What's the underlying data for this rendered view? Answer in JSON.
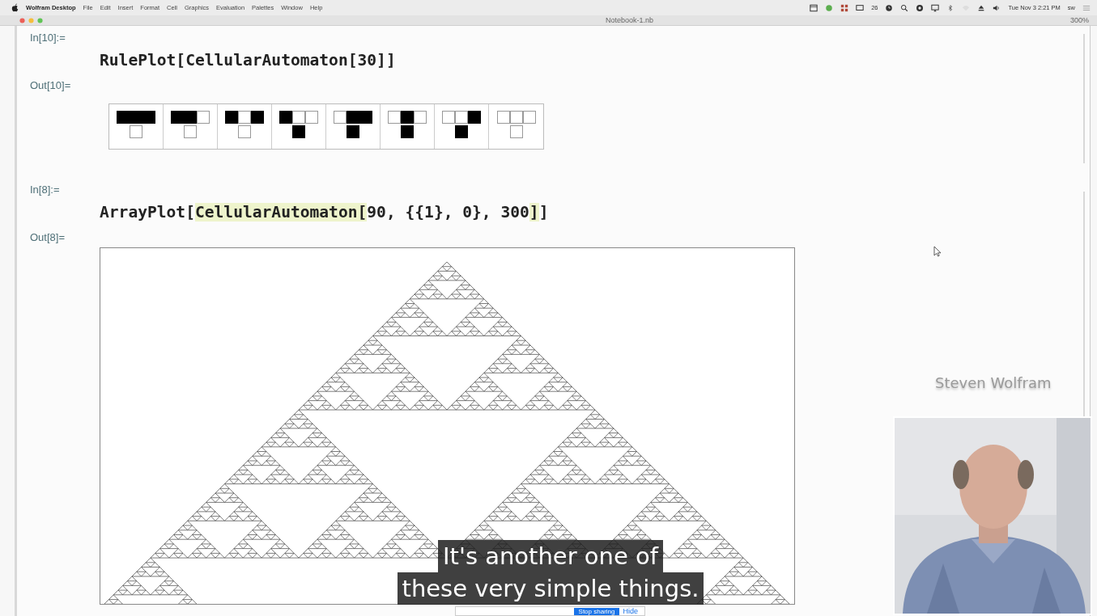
{
  "menu_bar": {
    "app": "Wolfram Desktop",
    "menus": [
      "File",
      "Edit",
      "Insert",
      "Format",
      "Cell",
      "Graphics",
      "Evaluation",
      "Palettes",
      "Window",
      "Help"
    ],
    "status": {
      "badge_count": "26",
      "clock": "Tue Nov 3  2:21 PM",
      "user": "sw"
    }
  },
  "window": {
    "title": "Notebook-1.nb",
    "zoom": "300%"
  },
  "cells": [
    {
      "kind": "input",
      "label": "In[10]:=",
      "code": [
        {
          "text": "RulePlot[CellularAutomaton[30]]",
          "highlighted": false
        }
      ]
    },
    {
      "kind": "rule_plot",
      "label": "Out[10]=",
      "cases": [
        {
          "top": [
            true,
            true,
            true
          ],
          "result": false
        },
        {
          "top": [
            true,
            true,
            false
          ],
          "result": false
        },
        {
          "top": [
            true,
            false,
            true
          ],
          "result": false
        },
        {
          "top": [
            true,
            false,
            false
          ],
          "result": true
        },
        {
          "top": [
            false,
            true,
            true
          ],
          "result": true
        },
        {
          "top": [
            false,
            true,
            false
          ],
          "result": true
        },
        {
          "top": [
            false,
            false,
            true
          ],
          "result": true
        },
        {
          "top": [
            false,
            false,
            false
          ],
          "result": false
        }
      ]
    },
    {
      "kind": "input",
      "label": "In[8]:=",
      "code": [
        {
          "text": "ArrayPlot[",
          "highlighted": false
        },
        {
          "text": "CellularAutomaton[",
          "highlighted": true
        },
        {
          "text": "90, {{1}, 0}, 300",
          "highlighted": false
        },
        {
          "text": "]",
          "highlighted": true
        },
        {
          "text": "]",
          "highlighted": false
        }
      ]
    },
    {
      "kind": "array_plot",
      "label": "Out[8]="
    }
  ],
  "video": {
    "speaker_name": "Steven Wolfram",
    "subtitles": [
      "It's another one of",
      "these very simple things."
    ]
  },
  "sharing_bar": {
    "button": "Stop sharing",
    "link": "Hide"
  }
}
